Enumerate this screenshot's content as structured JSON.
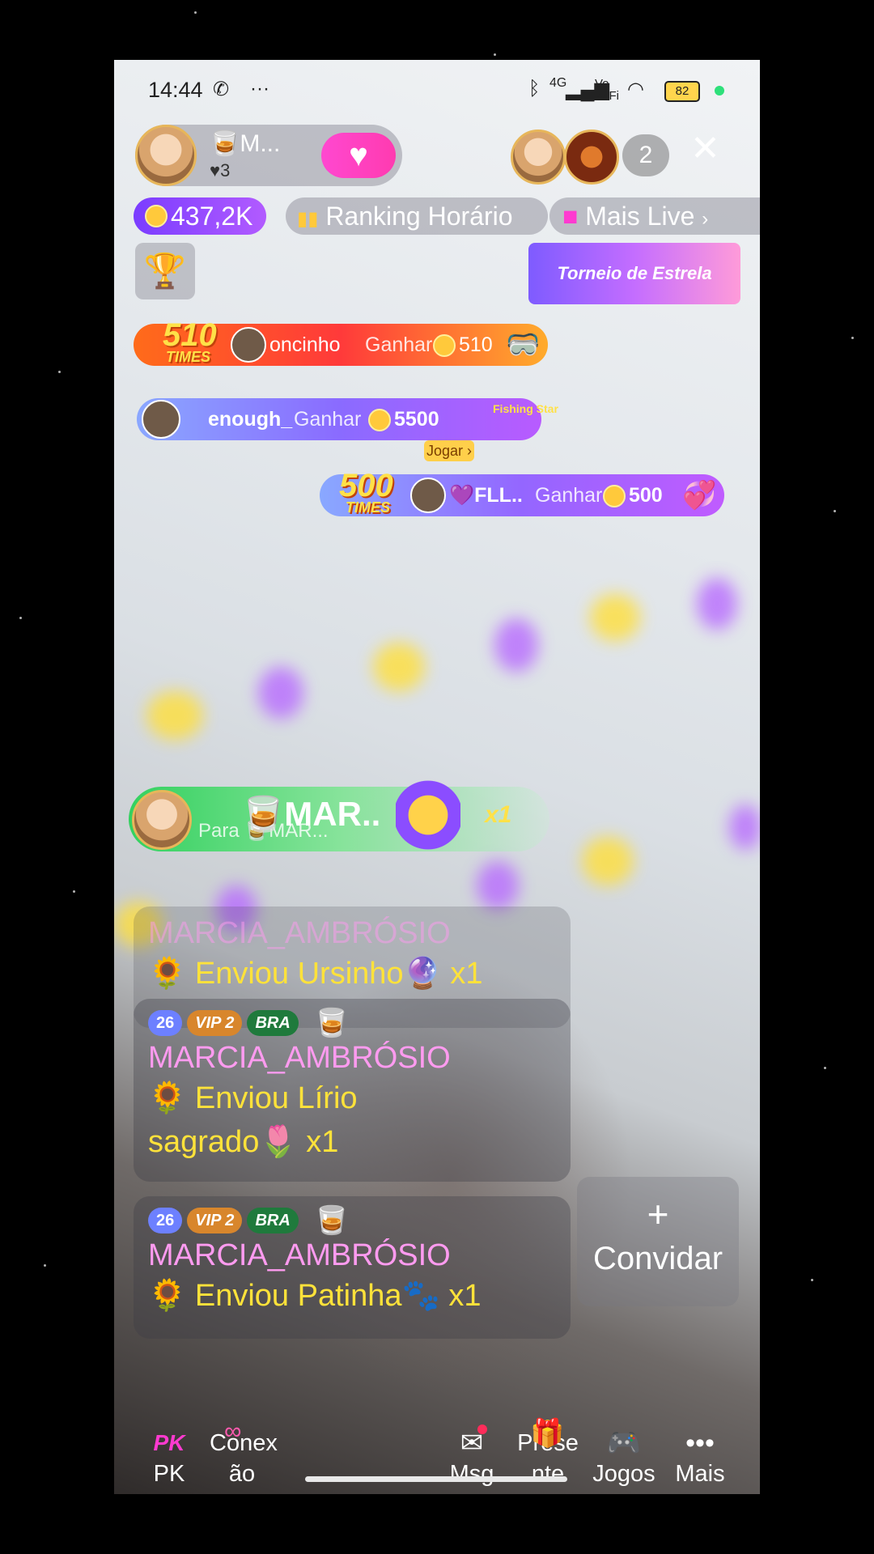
{
  "status_bar": {
    "time": "14:44",
    "whatsapp_icon": "whatsapp-icon",
    "more": "···",
    "network": "4G",
    "vowifi": "Vo WiFi",
    "battery": "82"
  },
  "host": {
    "name": "🥃M...",
    "likes": "♥3",
    "follow_icon": "heart-icon"
  },
  "viewers": {
    "count": "2",
    "close": "✕"
  },
  "top_pills": {
    "coins": "437,2K",
    "ranking": "Ranking Horário",
    "mais_live": "Mais Live",
    "chevron": "›"
  },
  "torneio": "Torneio de Estrela",
  "gift_banners": [
    {
      "times": "510",
      "times_label": "TIMES",
      "user": "oncinho",
      "action": "Ganhar",
      "amount": "510"
    },
    {
      "user": "enough_",
      "action": "Ganhar",
      "amount": "5500",
      "game": "Fishing Star",
      "cta": "Jogar"
    },
    {
      "times": "500",
      "times_label": "TIMES",
      "user": "💜FLL..",
      "action": "Ganhar",
      "amount": "500"
    }
  ],
  "entry_banner": {
    "name": "🥃MAR..",
    "sub": "Para 🥃MAR...",
    "count": "x1"
  },
  "chat": [
    {
      "user": "MARCIA_AMBRÓSIO",
      "message": "🌻 Enviou Ursinho🔮 x1"
    },
    {
      "level": "26",
      "vip": "VIP 2",
      "country": "BRA",
      "cup": "🥃",
      "user": "MARCIA_AMBRÓSIO",
      "message": "🌻 Enviou Lírio sagrado🌷 x1"
    },
    {
      "level": "26",
      "vip": "VIP 2",
      "country": "BRA",
      "cup": "🥃",
      "user": "MARCIA_AMBRÓSIO",
      "message": "🌻 Enviou Patinha🐾 x1"
    }
  ],
  "invite": {
    "plus": "+",
    "label": "Convidar"
  },
  "nav": {
    "pk": "PK",
    "conexao": "Conex ão",
    "msg": "Msg",
    "presente": "Prese nte",
    "jogos": "Jogos",
    "mais": "Mais"
  },
  "colors": {
    "coin_pill": "#7a3cff",
    "chat_user": "#ff9bf0",
    "chat_message": "#ffe23a",
    "accent_pink": "#ff48d0"
  }
}
